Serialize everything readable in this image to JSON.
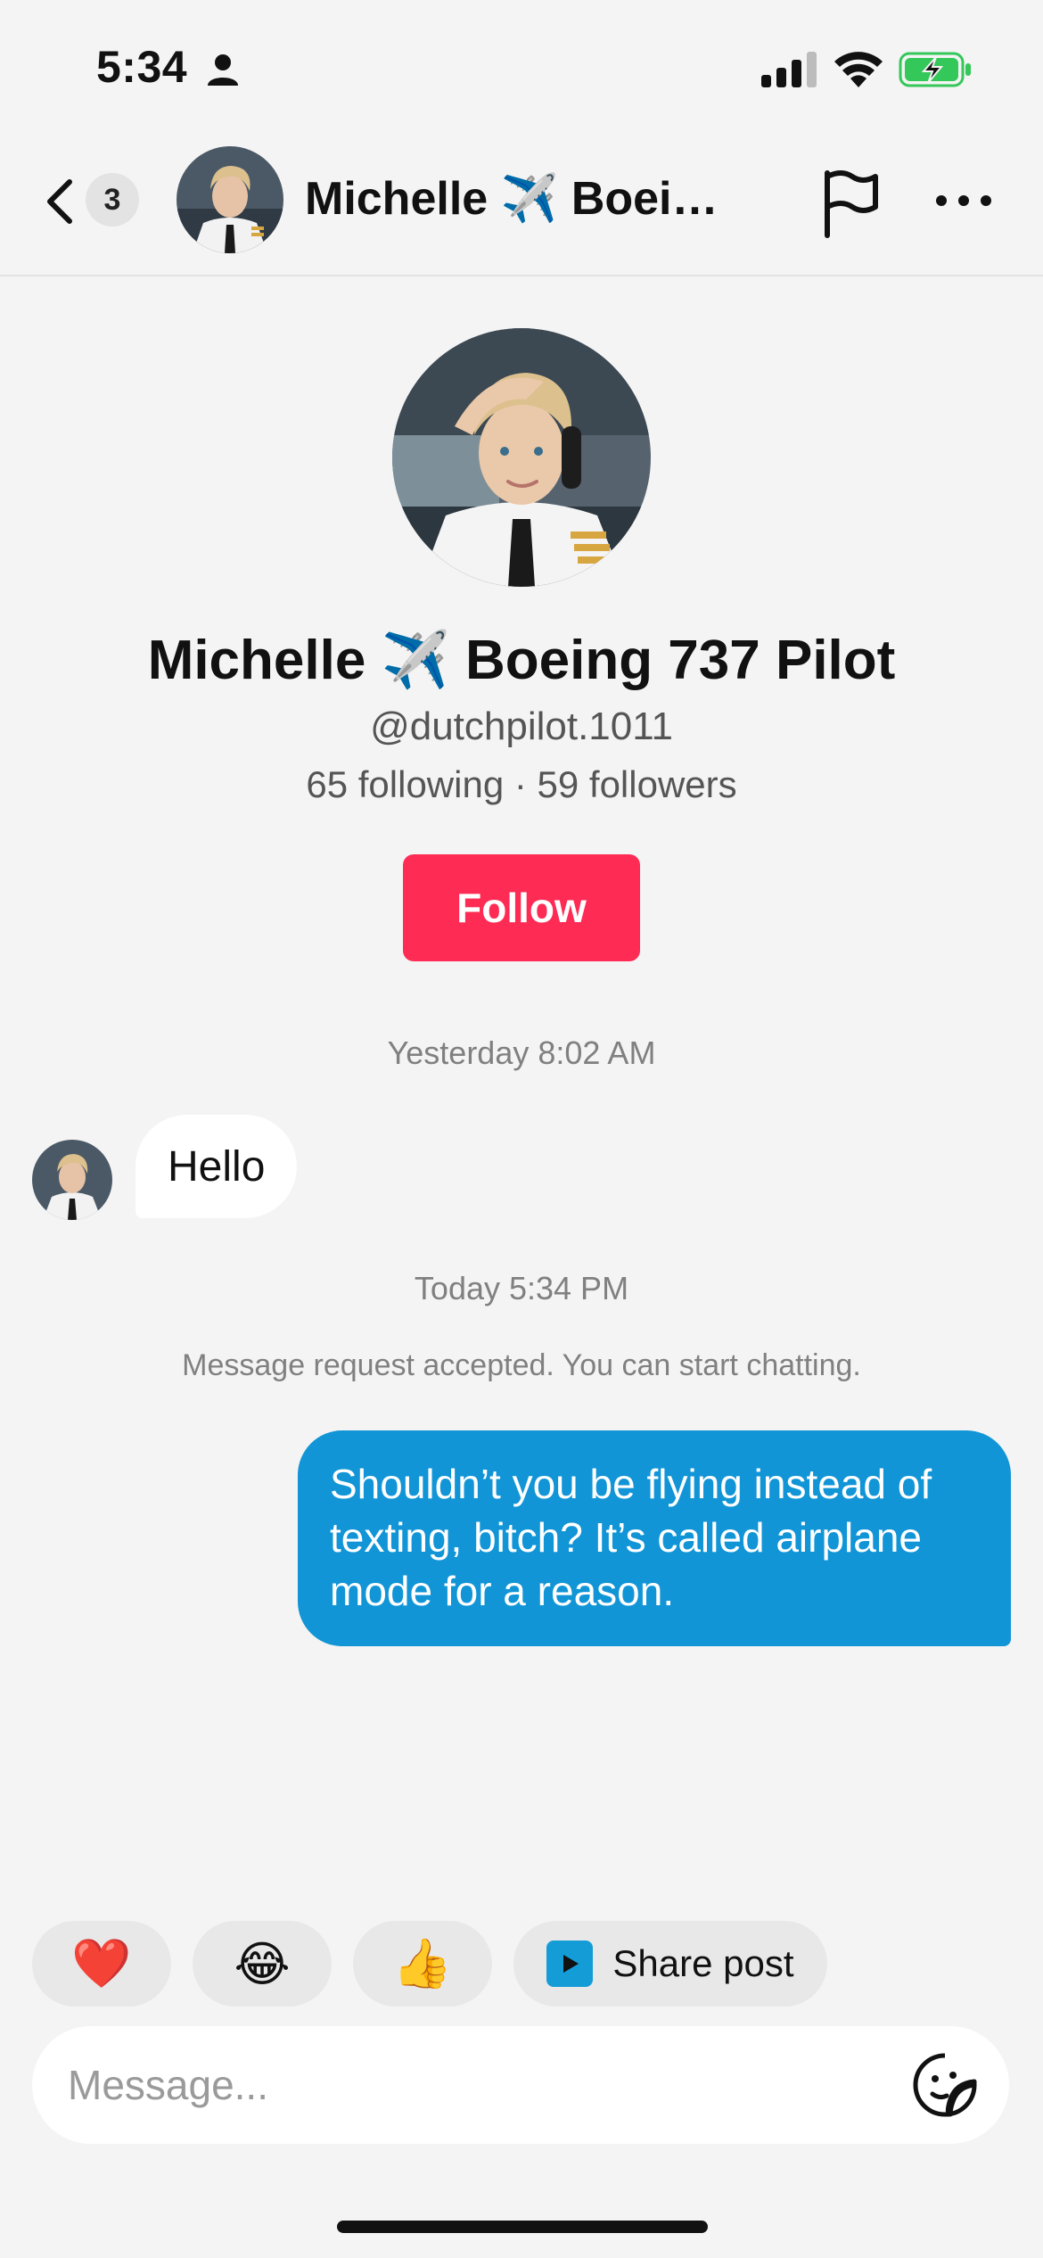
{
  "status_bar": {
    "time": "5:34",
    "icons": [
      "person-icon",
      "signal-icon",
      "wifi-icon",
      "battery-charging-icon"
    ],
    "battery_color": "#34c759"
  },
  "header": {
    "back_badge_count": "3",
    "name": "Michelle ✈️ Boeing 737 Pilot",
    "icons": [
      "chevron-left-icon",
      "flag-icon",
      "more-icon"
    ]
  },
  "profile": {
    "name": "Michelle ✈️ Boeing 737 Pilot",
    "handle": "@dutchpilot.1011",
    "stats": "65 following · 59 followers",
    "follow_label": "Follow",
    "follow_color": "#fe2c55"
  },
  "chat": {
    "timestamp_1": "Yesterday 8:02 AM",
    "incoming_message": "Hello",
    "timestamp_2": "Today 5:34 PM",
    "system_message": "Message request accepted. You can start chatting.",
    "outgoing_message": "Shouldn’t you be flying instead of texting, bitch? It’s called airplane mode for a reason.",
    "outgoing_color": "#1195d6"
  },
  "quick_replies": [
    {
      "emoji": "❤️",
      "icon": "heart-icon"
    },
    {
      "emoji": "😂",
      "icon": "laughing-emoji-icon"
    },
    {
      "emoji": "👍",
      "icon": "thumbs-up-icon"
    }
  ],
  "share_post": {
    "label": "Share post",
    "icon": "play-icon"
  },
  "composer": {
    "placeholder": "Message...",
    "value": "",
    "icon": "sticker-icon"
  }
}
